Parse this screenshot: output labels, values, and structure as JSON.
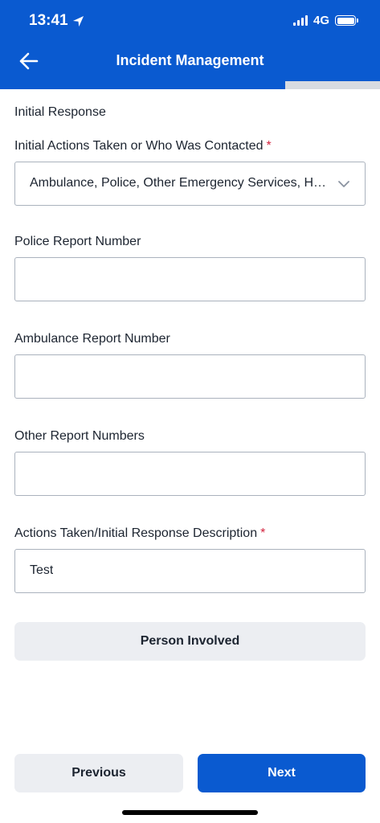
{
  "status_bar": {
    "time": "13:41",
    "network": "4G",
    "icons": [
      "location-arrow-icon",
      "signal-bars-icon",
      "battery-icon"
    ]
  },
  "nav": {
    "title": "Incident Management",
    "back_icon": "arrow-left-icon"
  },
  "progress": {
    "fraction": 0.75
  },
  "colors": {
    "primary": "#0a5ad0",
    "required": "#d3243f",
    "secondary_button": "#eceef2",
    "border": "#aab2bd"
  },
  "form": {
    "section_heading": "Initial Response",
    "required_marker": "*",
    "initial_actions": {
      "label": "Initial Actions Taken or Who Was Contacted",
      "value": "Ambulance, Police, Other Emergency Services, HR, Other",
      "icon": "chevron-down-icon"
    },
    "police_report": {
      "label": "Police Report Number",
      "value": ""
    },
    "ambulance_report": {
      "label": "Ambulance Report Number",
      "value": ""
    },
    "other_reports": {
      "label": "Other Report Numbers",
      "value": ""
    },
    "description": {
      "label": "Actions Taken/Initial Response Description",
      "value": "Test"
    }
  },
  "buttons": {
    "person_involved": "Person Involved",
    "previous": "Previous",
    "next": "Next"
  }
}
